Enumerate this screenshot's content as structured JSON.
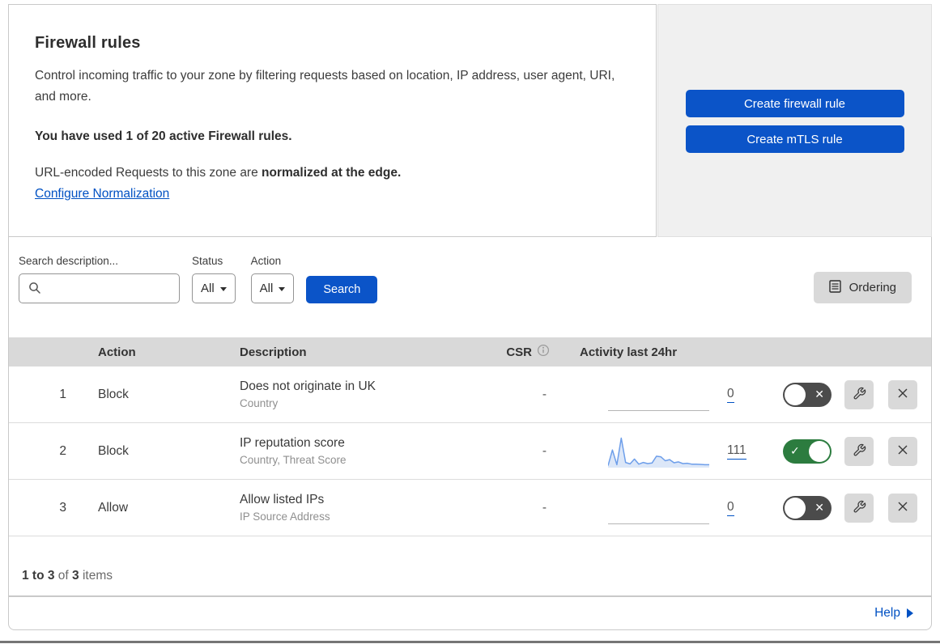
{
  "header": {
    "title": "Firewall rules",
    "description": "Control incoming traffic to your zone by filtering requests based on location, IP address, user agent, URI, and more.",
    "usage": "You have used 1 of 20 active Firewall rules.",
    "normalization_prefix": "URL-encoded Requests to this zone are ",
    "normalization_bold": "normalized at the edge.",
    "normalization_link": "Configure Normalization"
  },
  "cta": {
    "create_firewall_rule": "Create firewall rule",
    "create_mtls_rule": "Create mTLS rule"
  },
  "filters": {
    "search_label": "Search description...",
    "search_value": "",
    "status_label": "Status",
    "status_value": "All",
    "action_label": "Action",
    "action_value": "All",
    "search_button": "Search",
    "ordering_button": "Ordering"
  },
  "table": {
    "columns": {
      "action": "Action",
      "description": "Description",
      "csr": "CSR",
      "activity": "Activity last 24hr"
    },
    "rows": [
      {
        "priority": "1",
        "action": "Block",
        "description": "Does not originate in UK",
        "fields": "Country",
        "csr": "-",
        "activity_count": "0",
        "enabled": false
      },
      {
        "priority": "2",
        "action": "Block",
        "description": "IP reputation score",
        "fields": "Country, Threat Score",
        "csr": "-",
        "activity_count": "111",
        "enabled": true
      },
      {
        "priority": "3",
        "action": "Allow",
        "description": "Allow listed IPs",
        "fields": "IP Source Address",
        "csr": "-",
        "activity_count": "0",
        "enabled": false
      }
    ]
  },
  "footer": {
    "range": "1 to 3",
    "of_text": " of ",
    "total": "3",
    "items_text": " items",
    "help_link": "Help"
  },
  "chart_data": {
    "type": "line",
    "title": "Activity last 24hr sparkline (rule 2: IP reputation score)",
    "x_range": "last 24 hours",
    "values": [
      3,
      58,
      6,
      100,
      14,
      9,
      26,
      8,
      14,
      10,
      12,
      36,
      34,
      20,
      24,
      13,
      16,
      10,
      11,
      8,
      8,
      7,
      6,
      6
    ],
    "total_events": 111,
    "line_color": "#6d9eea",
    "fill_color": "#dce7f8"
  },
  "colors": {
    "accent_blue": "#0b54c8",
    "link_blue": "#0051c3",
    "toggle_on_green": "#2c7c3f",
    "toggle_off_gray": "#4b4b4b",
    "panel_gray": "#f0f0f0",
    "header_band_gray": "#d9d9d9"
  }
}
